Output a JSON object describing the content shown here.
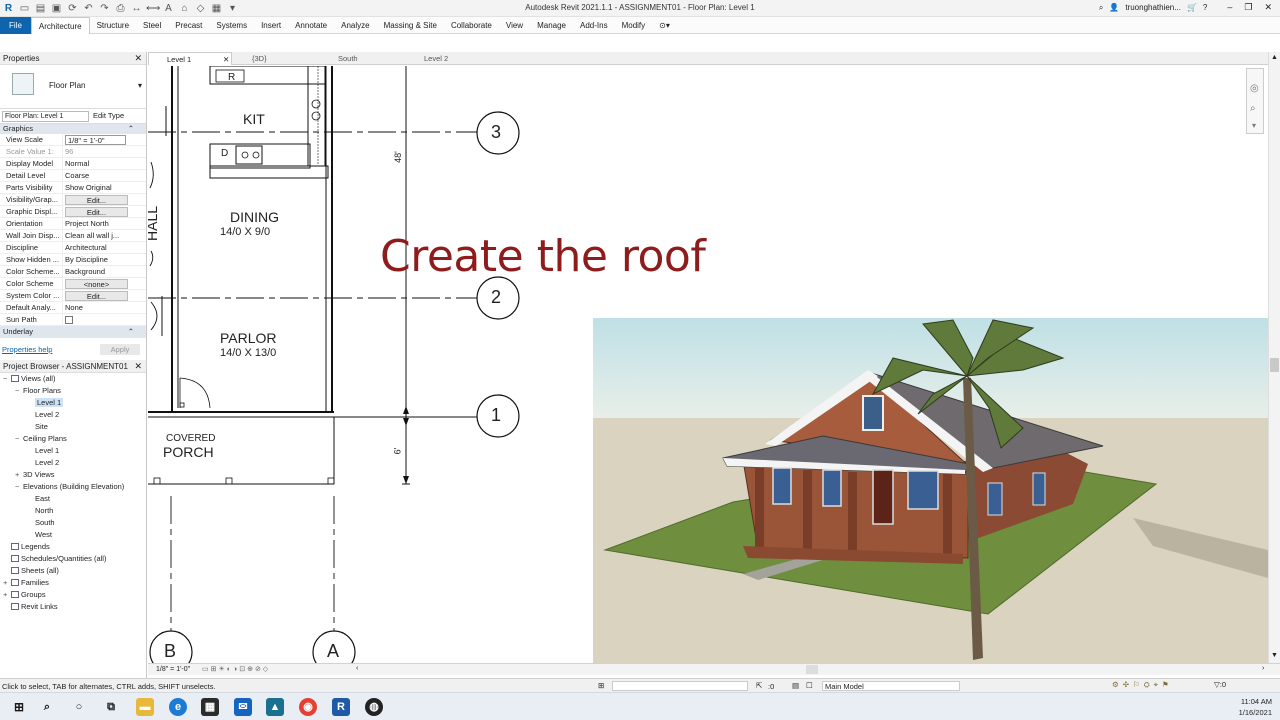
{
  "titlebar": {
    "title": "Autodesk Revit 2021.1.1 - ASSIGNMENT01 - Floor Plan: Level 1",
    "user": "truonghathien..."
  },
  "ribbon": {
    "tabs": [
      "File",
      "Architecture",
      "Structure",
      "Steel",
      "Precast",
      "Systems",
      "Insert",
      "Annotate",
      "Analyze",
      "Massing & Site",
      "Collaborate",
      "View",
      "Manage",
      "Add-Ins",
      "Modify"
    ],
    "active": "Architecture"
  },
  "properties": {
    "title": "Properties",
    "type_name": "Floor Plan",
    "instance_selector": "Floor Plan: Level 1",
    "edit_type": "Edit Type",
    "group_graphics": "Graphics",
    "rows": [
      {
        "k": "View Scale",
        "v": "1/8\" = 1'-0\"",
        "style": "box"
      },
      {
        "k": "Scale Value    1:",
        "v": "96",
        "style": "dim"
      },
      {
        "k": "Display Model",
        "v": "Normal",
        "style": ""
      },
      {
        "k": "Detail Level",
        "v": "Coarse",
        "style": ""
      },
      {
        "k": "Parts Visibility",
        "v": "Show Original",
        "style": ""
      },
      {
        "k": "Visibility/Grap...",
        "v": "Edit...",
        "style": "btn"
      },
      {
        "k": "Graphic Displ...",
        "v": "Edit...",
        "style": "btn"
      },
      {
        "k": "Orientation",
        "v": "Project North",
        "style": ""
      },
      {
        "k": "Wall Join Disp...",
        "v": "Clean all wall j...",
        "style": ""
      },
      {
        "k": "Discipline",
        "v": "Architectural",
        "style": ""
      },
      {
        "k": "Show Hidden ...",
        "v": "By Discipline",
        "style": ""
      },
      {
        "k": "Color Scheme...",
        "v": "Background",
        "style": ""
      },
      {
        "k": "Color Scheme",
        "v": "<none>",
        "style": "btn"
      },
      {
        "k": "System Color ...",
        "v": "Edit...",
        "style": "btn"
      },
      {
        "k": "Default Analy...",
        "v": "None",
        "style": ""
      },
      {
        "k": "Sun Path",
        "v": "",
        "style": "check"
      }
    ],
    "group_underlay": "Underlay",
    "help": "Properties help",
    "apply": "Apply"
  },
  "browser": {
    "title": "Project Browser - ASSIGNMENT01",
    "nodes": [
      {
        "label": "Views (all)",
        "indent": 0,
        "tw": "−",
        "icon": true
      },
      {
        "label": "Floor Plans",
        "indent": 1,
        "tw": "−",
        "icon": false
      },
      {
        "label": "Level 1",
        "indent": 2,
        "tw": "",
        "icon": false,
        "sel": true
      },
      {
        "label": "Level 2",
        "indent": 2,
        "tw": "",
        "icon": false
      },
      {
        "label": "Site",
        "indent": 2,
        "tw": "",
        "icon": false
      },
      {
        "label": "Ceiling Plans",
        "indent": 1,
        "tw": "−",
        "icon": false
      },
      {
        "label": "Level 1",
        "indent": 2,
        "tw": "",
        "icon": false
      },
      {
        "label": "Level 2",
        "indent": 2,
        "tw": "",
        "icon": false
      },
      {
        "label": "3D Views",
        "indent": 1,
        "tw": "+",
        "icon": false
      },
      {
        "label": "Elevations (Building Elevation)",
        "indent": 1,
        "tw": "−",
        "icon": false
      },
      {
        "label": "East",
        "indent": 2,
        "tw": "",
        "icon": false
      },
      {
        "label": "North",
        "indent": 2,
        "tw": "",
        "icon": false
      },
      {
        "label": "South",
        "indent": 2,
        "tw": "",
        "icon": false
      },
      {
        "label": "West",
        "indent": 2,
        "tw": "",
        "icon": false
      },
      {
        "label": "Legends",
        "indent": 0,
        "tw": "",
        "icon": true
      },
      {
        "label": "Schedules/Quantities (all)",
        "indent": 0,
        "tw": "",
        "icon": true
      },
      {
        "label": "Sheets (all)",
        "indent": 0,
        "tw": "",
        "icon": true
      },
      {
        "label": "Families",
        "indent": 0,
        "tw": "+",
        "icon": true
      },
      {
        "label": "Groups",
        "indent": 0,
        "tw": "+",
        "icon": true
      },
      {
        "label": "Revit Links",
        "indent": 0,
        "tw": "",
        "icon": true
      }
    ]
  },
  "viewtabs": [
    "Level 1",
    "{3D}",
    "South",
    "Level 2"
  ],
  "plan": {
    "rooms": {
      "kit": "KIT",
      "dining": "DINING",
      "dining_dim": "14/0 X 9/0",
      "parlor": "PARLOR",
      "parlor_dim": "14/0 X 13/0",
      "hall": "HALL",
      "covered": "COVERED",
      "porch": "PORCH",
      "r": "R",
      "d": "D"
    },
    "dims": {
      "d48": "48'",
      "d6": "6'"
    },
    "grids": {
      "g3": "3",
      "g2": "2",
      "g1": "1",
      "gB": "B",
      "gA": "A"
    }
  },
  "overlay": "Create the roof",
  "viewbar": {
    "scale": "1/8\" = 1'-0\""
  },
  "status": {
    "hint": "Click to select, TAB for alternates, CTRL adds, SHIFT unselects.",
    "zero": ":0",
    "model": "Main Model"
  },
  "clock": {
    "time": "11:04 AM",
    "date": "1/16/2021"
  }
}
